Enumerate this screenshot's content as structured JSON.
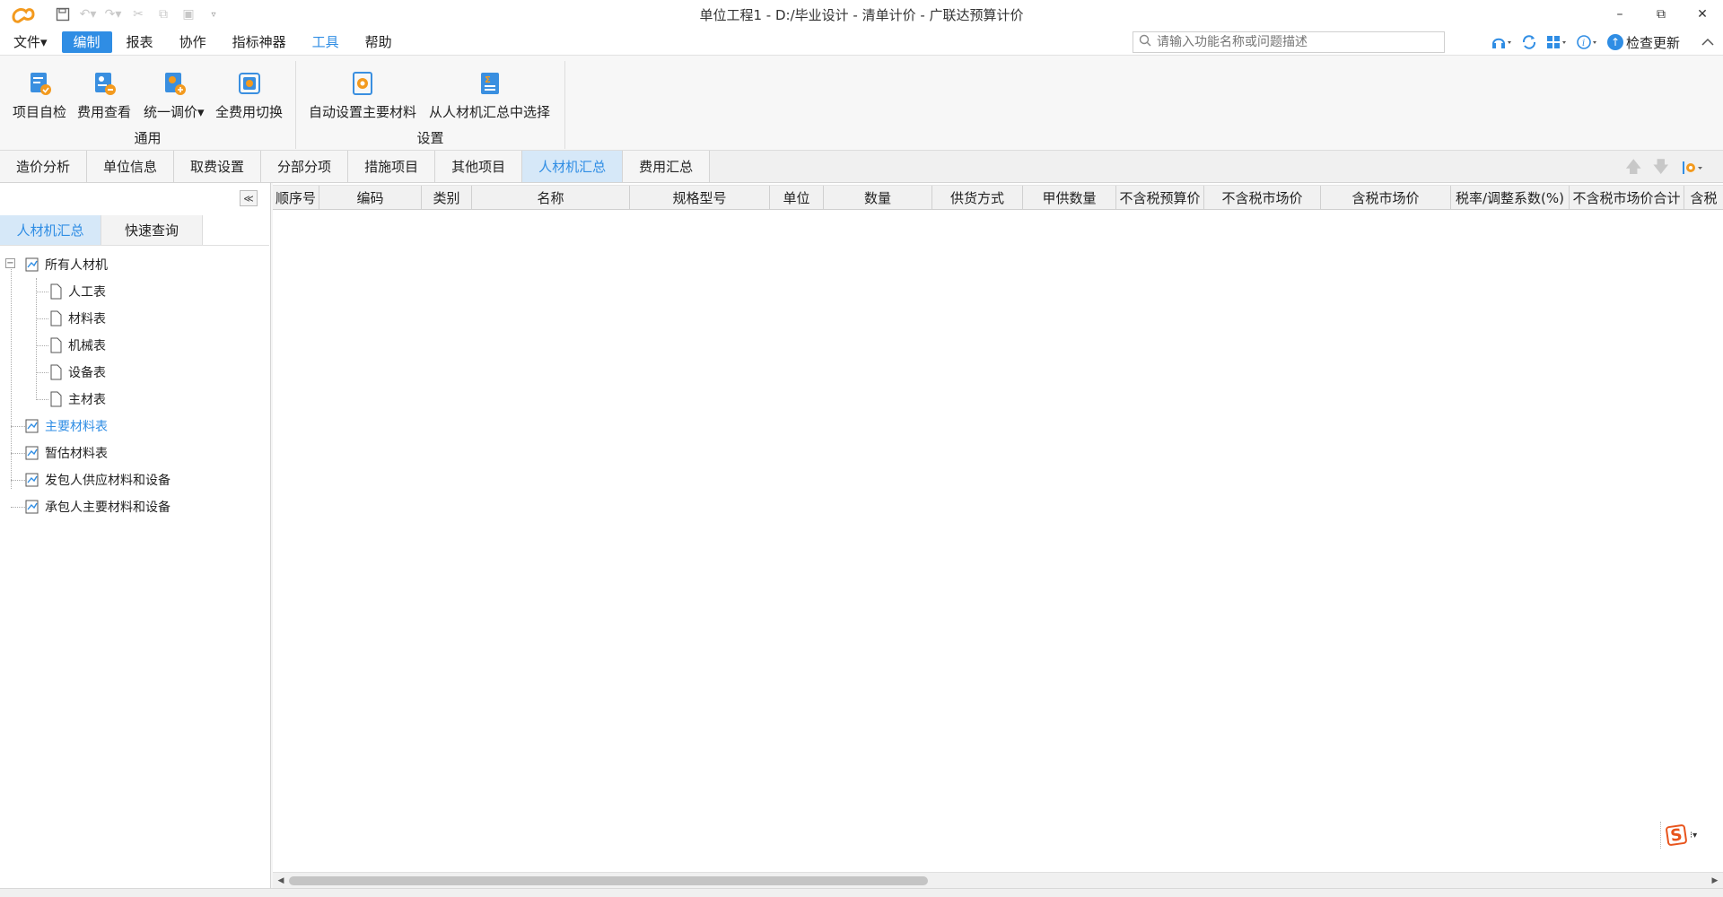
{
  "window": {
    "title": "单位工程1 - D:/毕业设计 - 清单计价 - 广联达预算计价",
    "min": "–",
    "restore": "⧉",
    "close": "✕"
  },
  "menu": {
    "items": [
      "文件▾",
      "编制",
      "报表",
      "协作",
      "指标神器",
      "工具",
      "帮助"
    ],
    "search_placeholder": "请输入功能名称或问题描述",
    "check_update": "检查更新"
  },
  "ribbon": {
    "group1_label": "通用",
    "group2_label": "设置",
    "buttons": [
      "项目自检",
      "费用查看",
      "统一调价▾",
      "全费用切换",
      "自动设置主要材料",
      "从人材机汇总中选择"
    ]
  },
  "tabs": [
    "造价分析",
    "单位信息",
    "取费设置",
    "分部分项",
    "措施项目",
    "其他项目",
    "人材机汇总",
    "费用汇总"
  ],
  "left_panel": {
    "subtabs": [
      "人材机汇总",
      "快速查询"
    ],
    "tree": {
      "root": "所有人材机",
      "children": [
        "人工表",
        "材料表",
        "机械表",
        "设备表",
        "主材表"
      ],
      "others": [
        "主要材料表",
        "暂估材料表",
        "发包人供应材料和设备",
        "承包人主要材料和设备"
      ]
    }
  },
  "grid": {
    "columns": [
      "顺序号",
      "编码",
      "类别",
      "名称",
      "规格型号",
      "单位",
      "数量",
      "供货方式",
      "甲供数量",
      "不含税预算价",
      "不含税市场价",
      "含税市场价",
      "税率/调整系数(%)",
      "不含税市场价合计",
      "含税"
    ]
  },
  "colors": {
    "accent": "#2f8de4",
    "active_tab_bg": "#d6e8f8"
  }
}
